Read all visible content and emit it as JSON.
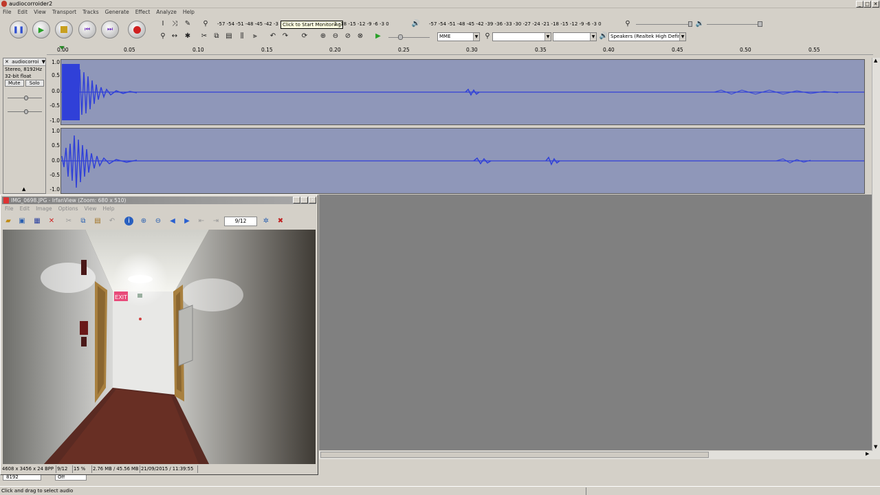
{
  "app": {
    "title": "audiocorroider2",
    "menu": [
      "File",
      "Edit",
      "View",
      "Transport",
      "Tracks",
      "Generate",
      "Effect",
      "Analyze",
      "Help"
    ],
    "meter_in_scale": "-57 -54 -51 -48 -45 -42 -3",
    "meter_in_scale2": "1 -18 -15 -12  -9  -6  -3  0",
    "monitor_tooltip": "Click to Start Monitoring",
    "meter_out_scale": "-57 -54 -51 -48 -45 -42 -39 -36 -33 -30 -27 -24 -21 -18 -15 -12  -9  -6  -3  0",
    "host": "MME",
    "input_device": "",
    "input_channels": "",
    "output_device": "Speakers (Realtek High Definiti"
  },
  "ruler": {
    "ticks": [
      "0.00",
      "0.05",
      "0.10",
      "0.15",
      "0.20",
      "0.25",
      "0.30",
      "0.35",
      "0.40",
      "0.45",
      "0.50",
      "0.55"
    ]
  },
  "track": {
    "name": "audiocorroi",
    "rate": "Stereo, 8192Hz",
    "format": "32-bit float",
    "mute": "Mute",
    "solo": "Solo",
    "scale": [
      "1.0",
      "0.5",
      "0.0",
      "-0.5",
      "-1.0"
    ]
  },
  "irfanview": {
    "title": "IMG_0698.JPG - IrfanView (Zoom: 680 x 510)",
    "menu": [
      "File",
      "Edit",
      "Image",
      "Options",
      "View",
      "Help"
    ],
    "page_counter": "9/12",
    "status": [
      "4608 x 3456 x 24 BPP",
      "9/12",
      "15 %",
      "2.76 MB / 45.56 MB",
      "21/09/2015 / 11:39:55"
    ],
    "exit_sign": "EXIT"
  },
  "selection_toolbar": {
    "rate": "8192",
    "snap": "Off"
  },
  "statusbar": {
    "text": "Click and drag to select audio"
  }
}
